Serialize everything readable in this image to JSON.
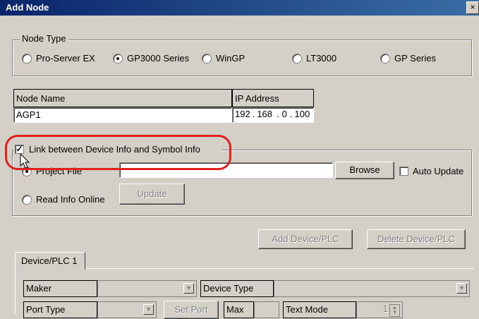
{
  "window": {
    "title": "Add Node",
    "close_glyph": "×"
  },
  "node_type": {
    "legend": "Node Type",
    "options": [
      {
        "label": "Pro-Server EX",
        "checked": false
      },
      {
        "label": "GP3000 Series",
        "checked": true
      },
      {
        "label": "WinGP",
        "checked": false
      },
      {
        "label": "LT3000",
        "checked": false
      },
      {
        "label": "GP Series",
        "checked": false
      }
    ]
  },
  "node_name": {
    "header": "Node Name",
    "value": "AGP1"
  },
  "ip_address": {
    "header": "IP Address",
    "octets": [
      "192",
      "168",
      "0",
      "100"
    ]
  },
  "link": {
    "checkbox_label": "Link between Device Info and Symbol Info",
    "checked": true,
    "project_file_label": "Project File",
    "project_file_value": "",
    "browse_label": "Browse",
    "auto_update_label": "Auto Update",
    "read_online_label": "Read Info Online",
    "update_label": "Update"
  },
  "device_buttons": {
    "add": "Add Device/PLC",
    "delete": "Delete Device/PLC"
  },
  "device_tab": {
    "label": "Device/PLC 1",
    "maker_label": "Maker",
    "device_type_label": "Device Type",
    "port_type_label": "Port Type",
    "set_port_label": "Set Port",
    "max_label": "Max",
    "text_mode_label": "Text Mode",
    "text_mode_value": "1"
  },
  "icons": {
    "cursor": "mouse-pointer-icon",
    "dropdown": "chevron-down-icon"
  },
  "colors": {
    "highlight": "#e0201c",
    "titlebar": "#0a246a"
  }
}
